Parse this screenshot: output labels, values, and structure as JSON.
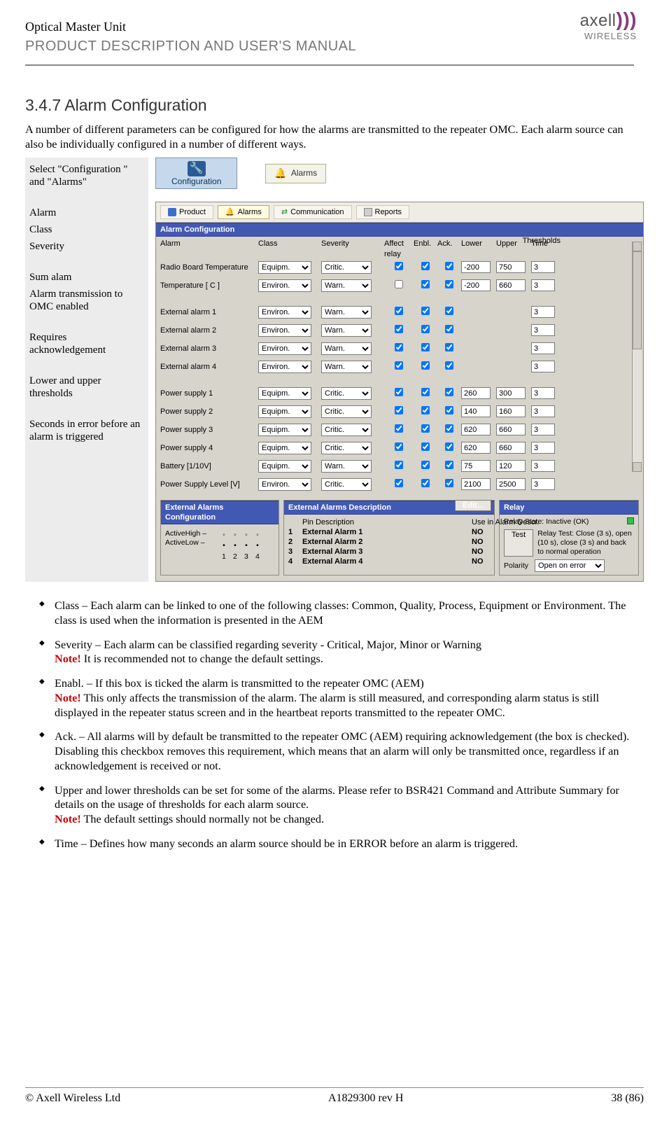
{
  "header": {
    "line1": "Optical Master Unit",
    "line2": "PRODUCT DESCRIPTION AND USER'S MANUAL",
    "brand": "axell",
    "brand_sub": "WIRELESS"
  },
  "section_number": "3.4.7",
  "section_title": "Alarm Configuration",
  "intro": "A number of different parameters can be configured for how the alarms are transmitted to the repeater OMC. Each alarm source can also be individually configured in a number of different ways.",
  "annot": {
    "select_text": "Select \"Configuration \" and \"Alarms\"",
    "alarm": "Alarm",
    "class": "Class",
    "severity": "Severity",
    "sum_alarm": "Sum alam",
    "enabled": "Alarm transmission to OMC enabled",
    "ack": "Requires acknowledgement",
    "thresholds": "Lower and upper thresholds",
    "time": "Seconds in error before an alarm is triggered"
  },
  "mini": {
    "cfg_label": "Configuration",
    "alarms_label": "Alarms"
  },
  "shot": {
    "tabs": {
      "product": "Product",
      "alarms": "Alarms",
      "communication": "Communication",
      "reports": "Reports"
    },
    "title_bar": "Alarm Configuration",
    "cols": {
      "alarm": "Alarm",
      "class": "Class",
      "severity": "Severity",
      "affect": "Affect relay",
      "enbl": "Enbl.",
      "ack": "Ack.",
      "thresholds": "Thresholds",
      "lower": "Lower",
      "upper": "Upper",
      "time": "Time"
    },
    "class_opts": [
      "Equipm.",
      "Environ."
    ],
    "sev_opts": [
      "Critic.",
      "Warn."
    ],
    "rows": [
      {
        "name": "Radio Board Temperature",
        "class": "Equipm.",
        "sev": "Critic.",
        "affect": true,
        "enbl": true,
        "ack": true,
        "lo": "-200",
        "up": "750",
        "t": "3"
      },
      {
        "name": "Temperature  [ C ]",
        "class": "Environ.",
        "sev": "Warn.",
        "affect": false,
        "enbl": true,
        "ack": true,
        "lo": "-200",
        "up": "660",
        "t": "3"
      },
      {
        "name": "External alarm 1",
        "class": "Environ.",
        "sev": "Warn.",
        "affect": true,
        "enbl": true,
        "ack": true,
        "lo": "",
        "up": "",
        "t": "3"
      },
      {
        "name": "External alarm 2",
        "class": "Environ.",
        "sev": "Warn.",
        "affect": true,
        "enbl": true,
        "ack": true,
        "lo": "",
        "up": "",
        "t": "3"
      },
      {
        "name": "External alarm 3",
        "class": "Environ.",
        "sev": "Warn.",
        "affect": true,
        "enbl": true,
        "ack": true,
        "lo": "",
        "up": "",
        "t": "3"
      },
      {
        "name": "External alarm 4",
        "class": "Environ.",
        "sev": "Warn.",
        "affect": true,
        "enbl": true,
        "ack": true,
        "lo": "",
        "up": "",
        "t": "3"
      },
      {
        "name": "Power supply 1",
        "class": "Equipm.",
        "sev": "Critic.",
        "affect": true,
        "enbl": true,
        "ack": true,
        "lo": "260",
        "up": "300",
        "t": "3"
      },
      {
        "name": "Power supply 2",
        "class": "Equipm.",
        "sev": "Critic.",
        "affect": true,
        "enbl": true,
        "ack": true,
        "lo": "140",
        "up": "160",
        "t": "3"
      },
      {
        "name": "Power supply 3",
        "class": "Equipm.",
        "sev": "Critic.",
        "affect": true,
        "enbl": true,
        "ack": true,
        "lo": "620",
        "up": "660",
        "t": "3"
      },
      {
        "name": "Power supply 4",
        "class": "Equipm.",
        "sev": "Critic.",
        "affect": true,
        "enbl": true,
        "ack": true,
        "lo": "620",
        "up": "660",
        "t": "3"
      },
      {
        "name": "Battery [1/10V]",
        "class": "Equipm.",
        "sev": "Warn.",
        "affect": true,
        "enbl": true,
        "ack": true,
        "lo": "75",
        "up": "120",
        "t": "3"
      },
      {
        "name": "Power Supply Level [V]",
        "class": "Environ.",
        "sev": "Critic.",
        "affect": true,
        "enbl": true,
        "ack": true,
        "lo": "2100",
        "up": "2500",
        "t": "3"
      }
    ],
    "bottom": {
      "ext_cfg_title": "External Alarms Configuration",
      "ext_cfg_high": "ActiveHigh",
      "ext_cfg_low": "ActiveLow",
      "ext_desc_title": "External Alarms Description",
      "edit": "Edit...",
      "pin_desc": "Pin Description",
      "use_in": "Use in Alarm Descr.",
      "ea1": "External Alarm 1",
      "ea1v": "NO",
      "ea2": "External Alarm 2",
      "ea2v": "NO",
      "ea3": "External Alarm 3",
      "ea3v": "NO",
      "ea4": "External Alarm 4",
      "ea4v": "NO",
      "relay_title": "Relay",
      "relay_state": "Relay State: Inactive (OK)",
      "test": "Test",
      "relay_note": "Relay Test: Close (3 s), open (10 s), close (3 s) and back to normal operation",
      "polarity": "Polarity",
      "polarity_val": "Open on error"
    }
  },
  "bullets": {
    "b1": "Class – Each alarm can be linked to one of the following classes: Common, Quality, Process, Equipment or Environment. The class is used when the information is presented in the AEM",
    "b2a": "Severity – Each alarm can be classified regarding severity - Critical, Major, Minor or Warning",
    "b2n": " It is recommended not to change the default settings.",
    "b3a": "Enabl. – If this box is ticked the alarm is transmitted to the repeater OMC (AEM)",
    "b3n": " This only affects the transmission of the alarm. The alarm is still measured, and corresponding alarm status is still displayed in the repeater status screen and in the heartbeat reports transmitted to the repeater OMC.",
    "b4": "Ack. – All alarms will by default be transmitted to the repeater OMC (AEM) requiring acknowledgement (the box is checked). Disabling this checkbox removes this requirement, which means that an alarm will only be transmitted once, regardless if an acknowledgement is received or not.",
    "b5a": "Upper and lower thresholds can be set for some of the alarms. Please refer to BSR421 Command and Attribute Summary for details on the usage of thresholds for each alarm source.",
    "b5n": " The default settings should normally not be changed.",
    "b6": "Time – Defines how many seconds an alarm source should be in ERROR before an alarm is triggered.",
    "note_label": "Note!"
  },
  "footer": {
    "left": "© Axell Wireless Ltd",
    "center": "A1829300 rev H",
    "right": "38 (86)"
  }
}
